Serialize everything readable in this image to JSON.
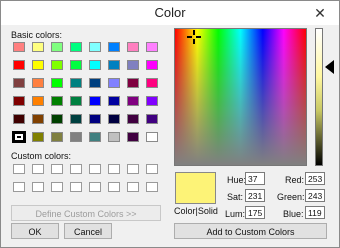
{
  "window": {
    "title": "Color"
  },
  "icons": {
    "close": "close-icon",
    "crosshair": "crosshair-icon",
    "lum_arrow": "arrow-left-icon"
  },
  "labels": {
    "basic_colors": "Basic colors:",
    "custom_colors": "Custom colors:",
    "color_solid": "Color|Solid",
    "hue": "Hue:",
    "sat": "Sat:",
    "lum": "Lum:",
    "red": "Red:",
    "green": "Green:",
    "blue": "Blue:"
  },
  "buttons": {
    "define": "Define Custom Colors >>",
    "ok": "OK",
    "cancel": "Cancel",
    "add": "Add to Custom Colors"
  },
  "values": {
    "hue": "37",
    "sat": "231",
    "lum": "175",
    "red": "253",
    "green": "243",
    "blue": "119"
  },
  "selected_color": "#fdf377",
  "basic_colors": [
    [
      "#ff8080",
      "#ffff80",
      "#80ff80",
      "#00ff80",
      "#80ffff",
      "#0080ff",
      "#ff80c0",
      "#ff80ff"
    ],
    [
      "#ff0000",
      "#ffff00",
      "#80ff00",
      "#00ff40",
      "#00ffff",
      "#0080c0",
      "#8080c0",
      "#ff00ff"
    ],
    [
      "#804040",
      "#ff8040",
      "#00ff00",
      "#008080",
      "#004080",
      "#8080ff",
      "#800040",
      "#ff0080"
    ],
    [
      "#800000",
      "#ff8000",
      "#008000",
      "#008040",
      "#0000ff",
      "#0000a0",
      "#800080",
      "#8000ff"
    ],
    [
      "#400000",
      "#804000",
      "#004000",
      "#004040",
      "#000080",
      "#000040",
      "#400040",
      "#400080"
    ],
    [
      "#000000",
      "#808000",
      "#808040",
      "#808080",
      "#408080",
      "#c0c0c0",
      "#400040",
      "#ffffff"
    ]
  ],
  "selected_basic": "5-0"
}
